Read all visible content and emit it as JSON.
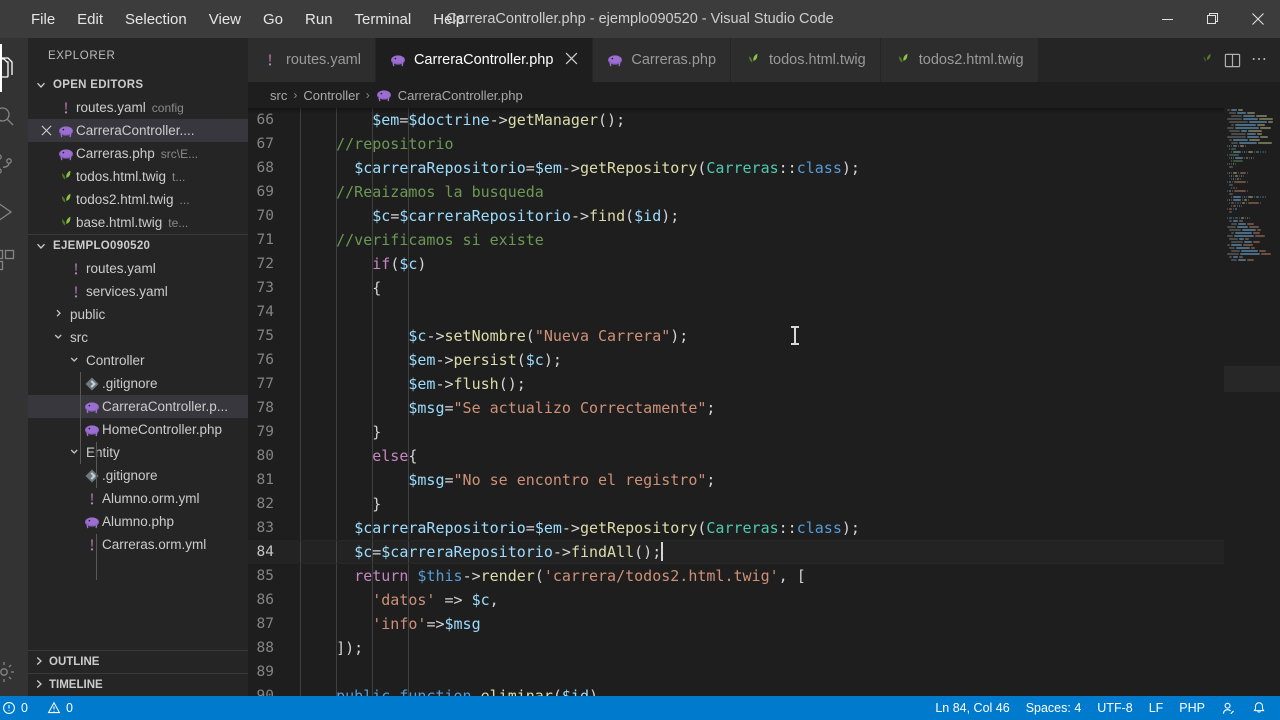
{
  "titlebar": {
    "menu": [
      "File",
      "Edit",
      "Selection",
      "View",
      "Go",
      "Run",
      "Terminal",
      "Help"
    ],
    "window_title": "CarreraController.php - ejemplo090520 - Visual Studio Code",
    "minimize": "minimize-icon",
    "restore": "restore-icon",
    "close": "close-icon"
  },
  "activitybar": {
    "items": [
      {
        "name": "explorer-icon",
        "active": true
      },
      {
        "name": "search-icon",
        "active": false
      },
      {
        "name": "source-control-icon",
        "active": false
      },
      {
        "name": "run-and-debug-icon",
        "active": false
      },
      {
        "name": "extensions-icon",
        "active": false
      }
    ],
    "bottom": [
      {
        "name": "settings-gear-icon",
        "active": false
      }
    ]
  },
  "sidebar": {
    "title": "EXPLORER",
    "open_editors": {
      "label": "OPEN EDITORS",
      "expanded": true,
      "items": [
        {
          "label": "routes.yaml",
          "desc": "config",
          "icon": "yaml-icon",
          "selected": false,
          "dirty": false
        },
        {
          "label": "CarreraController....",
          "desc": "",
          "icon": "php-icon",
          "selected": true,
          "dirty": false
        },
        {
          "label": "Carreras.php",
          "desc": "src\\E...",
          "icon": "php-icon",
          "selected": false,
          "dirty": false
        },
        {
          "label": "todos.html.twig",
          "desc": "t...",
          "icon": "twig-icon",
          "selected": false,
          "dirty": false
        },
        {
          "label": "todos2.html.twig",
          "desc": "...",
          "icon": "twig-icon",
          "selected": false,
          "dirty": false
        },
        {
          "label": "base.html.twig",
          "desc": "te...",
          "icon": "twig-icon",
          "selected": false,
          "dirty": false
        }
      ]
    },
    "project": {
      "label": "EJEMPLO090520",
      "expanded": true,
      "items": [
        {
          "label": "routes.yaml",
          "icon": "yaml-icon",
          "indent": 3,
          "type": "file",
          "selected": false
        },
        {
          "label": "services.yaml",
          "icon": "yaml-icon",
          "indent": 3,
          "type": "file",
          "selected": false
        },
        {
          "label": "public",
          "icon": "folder-collapsed",
          "indent": 2,
          "type": "folder",
          "selected": false
        },
        {
          "label": "src",
          "icon": "folder-expanded",
          "indent": 2,
          "type": "folder",
          "selected": false
        },
        {
          "label": "Controller",
          "icon": "folder-expanded",
          "indent": 3,
          "type": "folder",
          "selected": false
        },
        {
          "label": ".gitignore",
          "icon": "git-icon",
          "indent": 4,
          "type": "file",
          "selected": false
        },
        {
          "label": "CarreraController.p...",
          "icon": "php-icon",
          "indent": 4,
          "type": "file",
          "selected": true
        },
        {
          "label": "HomeController.php",
          "icon": "php-icon",
          "indent": 4,
          "type": "file",
          "selected": false
        },
        {
          "label": "Entity",
          "icon": "folder-expanded",
          "indent": 3,
          "type": "folder",
          "selected": false
        },
        {
          "label": ".gitignore",
          "icon": "git-icon",
          "indent": 4,
          "type": "file",
          "selected": false
        },
        {
          "label": "Alumno.orm.yml",
          "icon": "yaml-icon",
          "indent": 4,
          "type": "file",
          "selected": false
        },
        {
          "label": "Alumno.php",
          "icon": "php-icon",
          "indent": 4,
          "type": "file",
          "selected": false
        },
        {
          "label": "Carreras.orm.yml",
          "icon": "yaml-icon",
          "indent": 4,
          "type": "file",
          "selected": false
        }
      ]
    },
    "outline": {
      "label": "OUTLINE",
      "expanded": false
    },
    "timeline": {
      "label": "TIMELINE",
      "expanded": false
    }
  },
  "tabs": [
    {
      "label": "routes.yaml",
      "icon": "yaml-icon",
      "active": false,
      "close": false
    },
    {
      "label": "CarreraController.php",
      "icon": "php-icon",
      "active": true,
      "close": true
    },
    {
      "label": "Carreras.php",
      "icon": "php-icon",
      "active": false,
      "close": false
    },
    {
      "label": "todos.html.twig",
      "icon": "twig-icon",
      "active": false,
      "close": false
    },
    {
      "label": "todos2.html.twig",
      "icon": "twig-icon",
      "active": false,
      "close": false
    }
  ],
  "tabbar_actions": [
    {
      "name": "twig-icon-partial"
    },
    {
      "name": "split-editor-icon"
    },
    {
      "name": "more-actions-icon",
      "label": "..."
    }
  ],
  "breadcrumb": {
    "items": [
      "src",
      "Controller",
      "CarreraController.php"
    ],
    "separator": "›",
    "file_icon": "php-icon"
  },
  "editor": {
    "first_line_number": 66,
    "current_line": 84,
    "lines": [
      {
        "n": 66,
        "tokens": [
          {
            "t": "        ",
            "c": "pl"
          },
          {
            "t": "$em",
            "c": "var"
          },
          {
            "t": "=",
            "c": "pl"
          },
          {
            "t": "$doctrine",
            "c": "var"
          },
          {
            "t": "->",
            "c": "pl"
          },
          {
            "t": "getManager",
            "c": "fn"
          },
          {
            "t": "();",
            "c": "pl"
          }
        ]
      },
      {
        "n": 67,
        "tokens": [
          {
            "t": "    ",
            "c": "pl"
          },
          {
            "t": "//repositorio",
            "c": "com"
          }
        ]
      },
      {
        "n": 68,
        "tokens": [
          {
            "t": "      ",
            "c": "pl"
          },
          {
            "t": "$carreraRepositorio",
            "c": "var"
          },
          {
            "t": "=",
            "c": "pl"
          },
          {
            "t": "$em",
            "c": "var"
          },
          {
            "t": "->",
            "c": "pl"
          },
          {
            "t": "getRepository",
            "c": "fn"
          },
          {
            "t": "(",
            "c": "pl"
          },
          {
            "t": "Carreras",
            "c": "cls"
          },
          {
            "t": "::",
            "c": "pl"
          },
          {
            "t": "class",
            "c": "blue"
          },
          {
            "t": ");",
            "c": "pl"
          }
        ]
      },
      {
        "n": 69,
        "tokens": [
          {
            "t": "    ",
            "c": "pl"
          },
          {
            "t": "//Reaizamos la busqueda",
            "c": "com"
          }
        ]
      },
      {
        "n": 70,
        "tokens": [
          {
            "t": "        ",
            "c": "pl"
          },
          {
            "t": "$c",
            "c": "var"
          },
          {
            "t": "=",
            "c": "pl"
          },
          {
            "t": "$carreraRepositorio",
            "c": "var"
          },
          {
            "t": "->",
            "c": "pl"
          },
          {
            "t": "find",
            "c": "fn"
          },
          {
            "t": "(",
            "c": "pl"
          },
          {
            "t": "$id",
            "c": "var"
          },
          {
            "t": ");",
            "c": "pl"
          }
        ]
      },
      {
        "n": 71,
        "tokens": [
          {
            "t": "    ",
            "c": "pl"
          },
          {
            "t": "//verificamos si existe",
            "c": "com"
          }
        ]
      },
      {
        "n": 72,
        "tokens": [
          {
            "t": "        ",
            "c": "pl"
          },
          {
            "t": "if",
            "c": "kw"
          },
          {
            "t": "(",
            "c": "pl"
          },
          {
            "t": "$c",
            "c": "var"
          },
          {
            "t": ")",
            "c": "pl"
          }
        ]
      },
      {
        "n": 73,
        "tokens": [
          {
            "t": "        {",
            "c": "pl"
          }
        ]
      },
      {
        "n": 74,
        "tokens": []
      },
      {
        "n": 75,
        "tokens": [
          {
            "t": "            ",
            "c": "pl"
          },
          {
            "t": "$c",
            "c": "var"
          },
          {
            "t": "->",
            "c": "pl"
          },
          {
            "t": "setNombre",
            "c": "fn"
          },
          {
            "t": "(",
            "c": "pl"
          },
          {
            "t": "\"Nueva Carrera\"",
            "c": "str"
          },
          {
            "t": ");",
            "c": "pl"
          }
        ]
      },
      {
        "n": 76,
        "tokens": [
          {
            "t": "            ",
            "c": "pl"
          },
          {
            "t": "$em",
            "c": "var"
          },
          {
            "t": "->",
            "c": "pl"
          },
          {
            "t": "persist",
            "c": "fn"
          },
          {
            "t": "(",
            "c": "pl"
          },
          {
            "t": "$c",
            "c": "var"
          },
          {
            "t": ");",
            "c": "pl"
          }
        ]
      },
      {
        "n": 77,
        "tokens": [
          {
            "t": "            ",
            "c": "pl"
          },
          {
            "t": "$em",
            "c": "var"
          },
          {
            "t": "->",
            "c": "pl"
          },
          {
            "t": "flush",
            "c": "fn"
          },
          {
            "t": "();",
            "c": "pl"
          }
        ]
      },
      {
        "n": 78,
        "tokens": [
          {
            "t": "            ",
            "c": "pl"
          },
          {
            "t": "$msg",
            "c": "var"
          },
          {
            "t": "=",
            "c": "pl"
          },
          {
            "t": "\"Se actualizo Correctamente\"",
            "c": "str"
          },
          {
            "t": ";",
            "c": "pl"
          }
        ]
      },
      {
        "n": 79,
        "tokens": [
          {
            "t": "        }",
            "c": "pl"
          }
        ]
      },
      {
        "n": 80,
        "tokens": [
          {
            "t": "        ",
            "c": "pl"
          },
          {
            "t": "else",
            "c": "kw"
          },
          {
            "t": "{",
            "c": "pl"
          }
        ]
      },
      {
        "n": 81,
        "tokens": [
          {
            "t": "            ",
            "c": "pl"
          },
          {
            "t": "$msg",
            "c": "var"
          },
          {
            "t": "=",
            "c": "pl"
          },
          {
            "t": "\"No se encontro el registro\"",
            "c": "str"
          },
          {
            "t": ";",
            "c": "pl"
          }
        ]
      },
      {
        "n": 82,
        "tokens": [
          {
            "t": "        }",
            "c": "pl"
          }
        ]
      },
      {
        "n": 83,
        "tokens": [
          {
            "t": "      ",
            "c": "pl"
          },
          {
            "t": "$carreraRepositorio",
            "c": "var"
          },
          {
            "t": "=",
            "c": "pl"
          },
          {
            "t": "$em",
            "c": "var"
          },
          {
            "t": "->",
            "c": "pl"
          },
          {
            "t": "getRepository",
            "c": "fn"
          },
          {
            "t": "(",
            "c": "pl"
          },
          {
            "t": "Carreras",
            "c": "cls"
          },
          {
            "t": "::",
            "c": "pl"
          },
          {
            "t": "class",
            "c": "blue"
          },
          {
            "t": ");",
            "c": "pl"
          }
        ]
      },
      {
        "n": 84,
        "tokens": [
          {
            "t": "      ",
            "c": "pl"
          },
          {
            "t": "$c",
            "c": "var"
          },
          {
            "t": "=",
            "c": "pl"
          },
          {
            "t": "$carreraRepositorio",
            "c": "var"
          },
          {
            "t": "->",
            "c": "pl"
          },
          {
            "t": "findAll",
            "c": "fn"
          },
          {
            "t": "();",
            "c": "pl"
          }
        ],
        "caret": true
      },
      {
        "n": 85,
        "tokens": [
          {
            "t": "      ",
            "c": "pl"
          },
          {
            "t": "return",
            "c": "kw"
          },
          {
            "t": " ",
            "c": "pl"
          },
          {
            "t": "$this",
            "c": "blue"
          },
          {
            "t": "->",
            "c": "pl"
          },
          {
            "t": "render",
            "c": "fn"
          },
          {
            "t": "(",
            "c": "pl"
          },
          {
            "t": "'carrera/todos2.html.twig'",
            "c": "str"
          },
          {
            "t": ", [",
            "c": "pl"
          }
        ]
      },
      {
        "n": 86,
        "tokens": [
          {
            "t": "        ",
            "c": "pl"
          },
          {
            "t": "'datos'",
            "c": "str"
          },
          {
            "t": " => ",
            "c": "pl"
          },
          {
            "t": "$c",
            "c": "var"
          },
          {
            "t": ",",
            "c": "pl"
          }
        ]
      },
      {
        "n": 87,
        "tokens": [
          {
            "t": "        ",
            "c": "pl"
          },
          {
            "t": "'info'",
            "c": "str"
          },
          {
            "t": "=>",
            "c": "pl"
          },
          {
            "t": "$msg",
            "c": "var"
          }
        ]
      },
      {
        "n": 88,
        "tokens": [
          {
            "t": "    ]);",
            "c": "pl"
          }
        ]
      },
      {
        "n": 89,
        "tokens": []
      },
      {
        "n": 90,
        "tokens": [
          {
            "t": "    ",
            "c": "pl"
          },
          {
            "t": "public",
            "c": "blue"
          },
          {
            "t": " ",
            "c": "pl"
          },
          {
            "t": "function",
            "c": "blue"
          },
          {
            "t": " ",
            "c": "pl"
          },
          {
            "t": "eliminar",
            "c": "fn"
          },
          {
            "t": "(",
            "c": "pl"
          },
          {
            "t": "$id",
            "c": "var"
          },
          {
            "t": ")",
            "c": "pl"
          }
        ]
      }
    ]
  },
  "statusbar": {
    "left": [
      {
        "name": "problems-errors",
        "icon": "error-circle-icon",
        "label": "0"
      },
      {
        "name": "problems-warnings",
        "icon": "warning-triangle-icon",
        "label": "0"
      }
    ],
    "right": [
      {
        "name": "editor-position",
        "label": "Ln 84, Col 46"
      },
      {
        "name": "indentation",
        "label": "Spaces: 4"
      },
      {
        "name": "encoding",
        "label": "UTF-8"
      },
      {
        "name": "eol",
        "label": "LF"
      },
      {
        "name": "language-mode",
        "label": "PHP"
      },
      {
        "name": "live-share-icon",
        "label": ""
      },
      {
        "name": "notifications-bell-icon",
        "label": ""
      }
    ]
  },
  "colors": {
    "accent": "#007acc",
    "titlebar_bg": "#3c3c3c",
    "sidebar_bg": "#252526",
    "editor_bg": "#1e1e1e",
    "php_icon": "#8892bf",
    "twig_icon": "#7fb236",
    "yaml_icon": "#c586c0"
  }
}
